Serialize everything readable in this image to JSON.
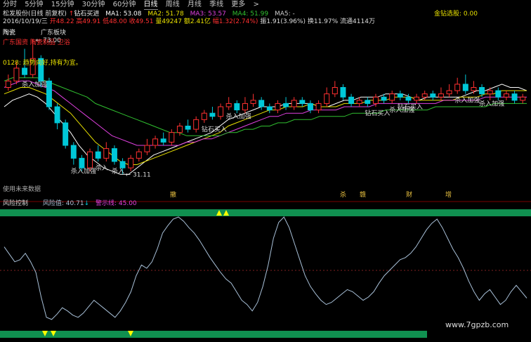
{
  "tabs": {
    "items": [
      {
        "label": "分时"
      },
      {
        "label": "5分钟"
      },
      {
        "label": "15分钟"
      },
      {
        "label": "30分钟"
      },
      {
        "label": "60分钟"
      },
      {
        "label": "日线"
      },
      {
        "label": "周线"
      },
      {
        "label": "月线"
      },
      {
        "label": "季线"
      },
      {
        "label": "更多"
      },
      {
        "label": ">"
      }
    ],
    "active_index": 5
  },
  "header": {
    "stock": "松发股份(日线 前复权)",
    "signal": "钻石买进",
    "ma1_label": "MA1: 53.08",
    "ma2_label": "MA2: 51.78",
    "ma3_label": "MA3: 53.57",
    "ma4_label": "MA4: 51.99",
    "ma5_label": "MA5: -",
    "right_label": "金钻选股: 0.00",
    "ohlc": {
      "date": "2016/10/19/三",
      "open": "开48.22",
      "high": "高49.91",
      "low": "低48.00",
      "close": "收49.51",
      "volume": "量49247",
      "amount": "额2.41亿",
      "change": "幅1.32(2.74%)",
      "amp": "振1.91(3.96%)",
      "turnover": "换11.97%",
      "float": "流通4114万"
    }
  },
  "tags": {
    "tag1": "陶瓷",
    "tag2": "广东板块",
    "concepts": "广东国资 陶瓷制品 卫浴",
    "advice": "0128: 趋势向好,持有为宜。",
    "future": "使用未来数据"
  },
  "colors": {
    "bg": "#000000",
    "up": "#ff3030",
    "down": "#00c8d8",
    "yellow": "#ffff00",
    "ma_white": "#ffffff",
    "ma_yellow": "#e8e000",
    "ma_magenta": "#e040e0",
    "ma_green": "#30c030",
    "risk_line": "#a8c0d8",
    "band_green": "#109050"
  },
  "chart_data": [
    {
      "type": "candlestick",
      "price_markers": {
        "high_label": "73.00",
        "low_label": "31.11"
      },
      "annotations": [
        {
          "text": "杀入加强"
        },
        {
          "text": "杀入加强"
        },
        {
          "text": "杀入"
        },
        {
          "text": "杀入"
        },
        {
          "text": "钻石买入"
        },
        {
          "text": "杀入加强"
        },
        {
          "text": "钻石买入"
        },
        {
          "text": "杀入加强"
        },
        {
          "text": "钻石买入"
        },
        {
          "text": "杀入加强"
        },
        {
          "text": "杀入加强"
        }
      ],
      "bottom_markers": [
        {
          "text": "撤"
        },
        {
          "text": "杀"
        },
        {
          "text": "赣"
        },
        {
          "text": "财"
        },
        {
          "text": "增"
        }
      ],
      "series": [
        {
          "name": "MA1",
          "values": [
            52,
            54,
            55,
            56,
            55,
            53,
            50,
            47,
            44,
            40,
            37,
            35,
            33,
            32,
            31,
            31,
            33,
            35,
            37,
            38,
            39,
            40,
            41,
            42,
            43,
            44,
            46,
            48,
            49,
            50,
            51,
            52,
            52,
            52,
            53,
            53,
            53,
            53,
            52,
            52,
            53,
            54,
            54,
            55,
            55,
            55,
            56,
            56,
            56,
            55,
            54,
            55,
            55,
            55,
            55,
            55,
            56,
            57,
            57,
            58,
            59,
            58,
            58,
            57
          ]
        },
        {
          "name": "MA2",
          "values": [
            56,
            57,
            58,
            58,
            57,
            56,
            54,
            52,
            50,
            47,
            44,
            41,
            39,
            37,
            35,
            34,
            34,
            35,
            36,
            37,
            38,
            39,
            40,
            41,
            42,
            43,
            44,
            46,
            47,
            48,
            49,
            50,
            51,
            51,
            52,
            52,
            52,
            53,
            52,
            52,
            52,
            53,
            53,
            53,
            54,
            54,
            54,
            55,
            55,
            55,
            54,
            54,
            54,
            54,
            54,
            55,
            55,
            55,
            56,
            56,
            57,
            57,
            57,
            57
          ]
        },
        {
          "name": "MA3",
          "values": [
            58,
            59,
            60,
            60,
            59,
            58,
            57,
            55,
            53,
            51,
            49,
            47,
            45,
            43,
            42,
            41,
            40,
            40,
            40,
            40,
            40,
            40,
            41,
            41,
            42,
            42,
            43,
            44,
            45,
            46,
            47,
            48,
            49,
            49,
            50,
            50,
            50,
            51,
            51,
            51,
            51,
            52,
            52,
            52,
            52,
            53,
            53,
            53,
            53,
            53,
            53,
            53,
            53,
            54,
            54,
            54,
            54,
            54,
            55,
            55,
            55,
            55,
            55,
            55
          ]
        },
        {
          "name": "MA4",
          "values": [
            60,
            61,
            61,
            61,
            61,
            60,
            59,
            58,
            57,
            56,
            55,
            53,
            52,
            51,
            50,
            49,
            48,
            47,
            46,
            45,
            44,
            44,
            43,
            43,
            43,
            43,
            43,
            44,
            44,
            45,
            45,
            46,
            46,
            47,
            47,
            48,
            48,
            48,
            49,
            49,
            49,
            49,
            50,
            50,
            50,
            50,
            51,
            51,
            51,
            51,
            51,
            51,
            52,
            52,
            52,
            52,
            52,
            52,
            52,
            53,
            53,
            53,
            53,
            53
          ]
        }
      ],
      "candles": [
        {
          "o": 58,
          "c": 60,
          "h": 62,
          "l": 57
        },
        {
          "o": 60,
          "c": 64,
          "h": 66,
          "l": 59
        },
        {
          "o": 64,
          "c": 62,
          "h": 70,
          "l": 61
        },
        {
          "o": 62,
          "c": 67,
          "h": 73,
          "l": 61
        },
        {
          "o": 67,
          "c": 60,
          "h": 68,
          "l": 58
        },
        {
          "o": 60,
          "c": 52,
          "h": 61,
          "l": 51
        },
        {
          "o": 52,
          "c": 47,
          "h": 53,
          "l": 45
        },
        {
          "o": 47,
          "c": 40,
          "h": 48,
          "l": 39
        },
        {
          "o": 40,
          "c": 36,
          "h": 41,
          "l": 34
        },
        {
          "o": 36,
          "c": 33,
          "h": 37,
          "l": 32
        },
        {
          "o": 33,
          "c": 38,
          "h": 39,
          "l": 32
        },
        {
          "o": 38,
          "c": 36,
          "h": 40,
          "l": 35
        },
        {
          "o": 36,
          "c": 39,
          "h": 41,
          "l": 35
        },
        {
          "o": 39,
          "c": 35,
          "h": 40,
          "l": 34
        },
        {
          "o": 35,
          "c": 33,
          "h": 36,
          "l": 31.11
        },
        {
          "o": 33,
          "c": 36,
          "h": 37,
          "l": 32
        },
        {
          "o": 36,
          "c": 38,
          "h": 39,
          "l": 35
        },
        {
          "o": 38,
          "c": 40,
          "h": 42,
          "l": 37
        },
        {
          "o": 40,
          "c": 42,
          "h": 43,
          "l": 39
        },
        {
          "o": 42,
          "c": 41,
          "h": 44,
          "l": 40
        },
        {
          "o": 41,
          "c": 44,
          "h": 45,
          "l": 40
        },
        {
          "o": 44,
          "c": 46,
          "h": 47,
          "l": 43
        },
        {
          "o": 46,
          "c": 45,
          "h": 48,
          "l": 44
        },
        {
          "o": 45,
          "c": 48,
          "h": 49,
          "l": 44
        },
        {
          "o": 48,
          "c": 50,
          "h": 51,
          "l": 47
        },
        {
          "o": 50,
          "c": 49,
          "h": 52,
          "l": 48
        },
        {
          "o": 49,
          "c": 52,
          "h": 53,
          "l": 48
        },
        {
          "o": 52,
          "c": 53,
          "h": 55,
          "l": 51
        },
        {
          "o": 53,
          "c": 51,
          "h": 54,
          "l": 50
        },
        {
          "o": 51,
          "c": 53,
          "h": 55,
          "l": 50
        },
        {
          "o": 53,
          "c": 54,
          "h": 56,
          "l": 52
        },
        {
          "o": 54,
          "c": 52,
          "h": 55,
          "l": 51
        },
        {
          "o": 52,
          "c": 51,
          "h": 53,
          "l": 50
        },
        {
          "o": 51,
          "c": 53,
          "h": 54,
          "l": 50
        },
        {
          "o": 53,
          "c": 52,
          "h": 55,
          "l": 51
        },
        {
          "o": 52,
          "c": 54,
          "h": 55,
          "l": 51
        },
        {
          "o": 54,
          "c": 53,
          "h": 55,
          "l": 52
        },
        {
          "o": 53,
          "c": 51,
          "h": 54,
          "l": 50
        },
        {
          "o": 51,
          "c": 53,
          "h": 54,
          "l": 50
        },
        {
          "o": 53,
          "c": 56,
          "h": 58,
          "l": 52
        },
        {
          "o": 56,
          "c": 58,
          "h": 60,
          "l": 55
        },
        {
          "o": 58,
          "c": 55,
          "h": 59,
          "l": 54
        },
        {
          "o": 55,
          "c": 53,
          "h": 56,
          "l": 52
        },
        {
          "o": 53,
          "c": 54,
          "h": 55,
          "l": 52
        },
        {
          "o": 54,
          "c": 53,
          "h": 55,
          "l": 52
        },
        {
          "o": 53,
          "c": 55,
          "h": 56,
          "l": 52
        },
        {
          "o": 55,
          "c": 54,
          "h": 56,
          "l": 53
        },
        {
          "o": 54,
          "c": 56,
          "h": 57,
          "l": 53
        },
        {
          "o": 56,
          "c": 55,
          "h": 57,
          "l": 54
        },
        {
          "o": 55,
          "c": 54,
          "h": 56,
          "l": 53
        },
        {
          "o": 54,
          "c": 55,
          "h": 56,
          "l": 53
        },
        {
          "o": 55,
          "c": 56,
          "h": 57,
          "l": 54
        },
        {
          "o": 56,
          "c": 55,
          "h": 57,
          "l": 54
        },
        {
          "o": 55,
          "c": 56,
          "h": 58,
          "l": 54
        },
        {
          "o": 56,
          "c": 57,
          "h": 59,
          "l": 55
        },
        {
          "o": 57,
          "c": 59,
          "h": 61,
          "l": 56
        },
        {
          "o": 59,
          "c": 57,
          "h": 62,
          "l": 56
        },
        {
          "o": 57,
          "c": 58,
          "h": 60,
          "l": 56
        },
        {
          "o": 58,
          "c": 56,
          "h": 59,
          "l": 55
        },
        {
          "o": 56,
          "c": 57,
          "h": 58,
          "l": 54
        },
        {
          "o": 57,
          "c": 55,
          "h": 58,
          "l": 54
        },
        {
          "o": 55,
          "c": 56,
          "h": 57,
          "l": 54
        },
        {
          "o": 56,
          "c": 54,
          "h": 57,
          "l": 53
        },
        {
          "o": 54,
          "c": 55,
          "h": 56,
          "l": 53
        }
      ]
    },
    {
      "type": "line",
      "title": "风险控制",
      "risk_label": "风险值: 40.71",
      "warn_label": "警示线: 45.00",
      "ylim": [
        0,
        100
      ],
      "series": [
        {
          "name": "风险值",
          "values": [
            72,
            65,
            58,
            60,
            66,
            58,
            48,
            25,
            6,
            4,
            9,
            15,
            12,
            8,
            6,
            10,
            16,
            22,
            18,
            14,
            10,
            6,
            12,
            20,
            30,
            45,
            55,
            52,
            58,
            70,
            85,
            92,
            98,
            100,
            96,
            90,
            85,
            78,
            70,
            62,
            55,
            48,
            42,
            38,
            30,
            22,
            18,
            12,
            20,
            35,
            55,
            80,
            95,
            100,
            90,
            75,
            60,
            45,
            35,
            28,
            22,
            18,
            20,
            24,
            28,
            32,
            30,
            26,
            22,
            25,
            30,
            38,
            45,
            50,
            55,
            60,
            62,
            66,
            72,
            80,
            88,
            94,
            98,
            90,
            80,
            70,
            62,
            52,
            40,
            30,
            22,
            28,
            32,
            25,
            18,
            22,
            30,
            36,
            30,
            24
          ]
        }
      ]
    }
  ],
  "watermark": "www.7gpzb.com"
}
